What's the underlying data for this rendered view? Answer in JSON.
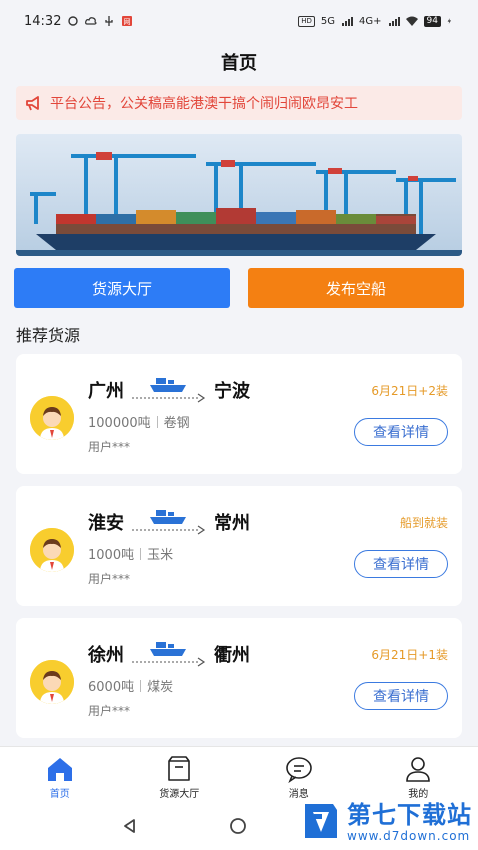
{
  "status_bar": {
    "time": "14:32",
    "network_labels": [
      "HD",
      "5G",
      "4G+"
    ],
    "battery": "94"
  },
  "header": {
    "title": "首页"
  },
  "notice": {
    "text": "平台公告，公关稿高能港澳干搞个闹归闹欧昂安工"
  },
  "actions": {
    "cargo_hall": "货源大厅",
    "publish_ship": "发布空船"
  },
  "section": {
    "title": "推荐货源"
  },
  "cards": [
    {
      "from": "广州",
      "to": "宁波",
      "weight": "100000吨",
      "goods": "卷钢",
      "user": "用户***",
      "date": "6月21日+2装",
      "detail": "查看详情"
    },
    {
      "from": "淮安",
      "to": "常州",
      "weight": "1000吨",
      "goods": "玉米",
      "user": "用户***",
      "date": "船到就装",
      "detail": "查看详情"
    },
    {
      "from": "徐州",
      "to": "衢州",
      "weight": "6000吨",
      "goods": "煤炭",
      "user": "用户***",
      "date": "6月21日+1装",
      "detail": "查看详情"
    }
  ],
  "tabbar": {
    "home": "首页",
    "cargo": "货源大厅",
    "messages": "消息",
    "mine": "我的"
  },
  "colors": {
    "primary_blue": "#2d7cf6",
    "orange": "#f48012",
    "notice_red": "#e2463a",
    "date_orange": "#e59a28"
  },
  "watermark": {
    "title": "第七下载站",
    "url": "www.d7down.com"
  }
}
